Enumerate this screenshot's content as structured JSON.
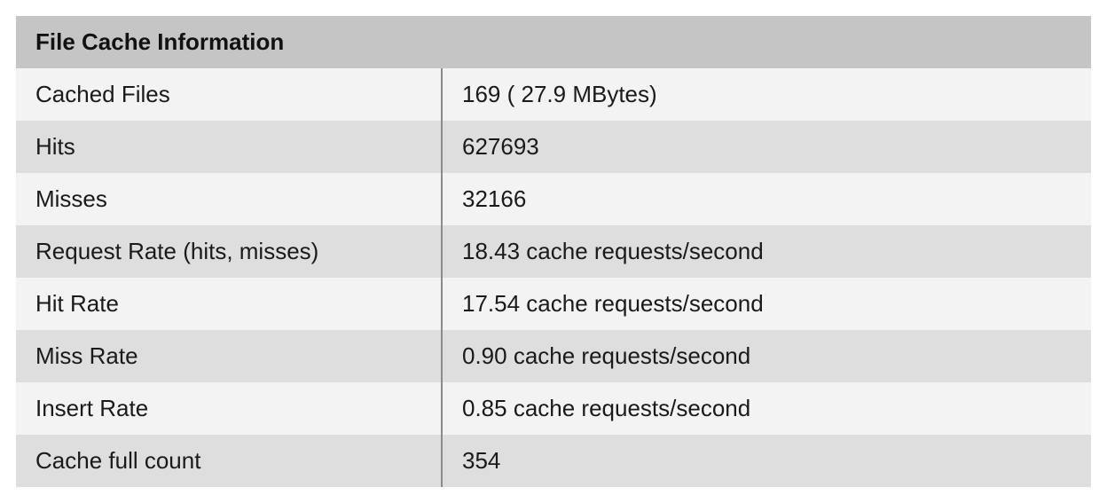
{
  "title": "File Cache Information",
  "rows": [
    {
      "label": "Cached Files",
      "value": "169 ( 27.9 MBytes)"
    },
    {
      "label": "Hits",
      "value": "627693"
    },
    {
      "label": "Misses",
      "value": "32166"
    },
    {
      "label": "Request Rate (hits, misses)",
      "value": "18.43 cache requests/second"
    },
    {
      "label": "Hit Rate",
      "value": "17.54 cache requests/second"
    },
    {
      "label": "Miss Rate",
      "value": "0.90 cache requests/second"
    },
    {
      "label": "Insert Rate",
      "value": "0.85 cache requests/second"
    },
    {
      "label": "Cache full count",
      "value": "354"
    }
  ]
}
